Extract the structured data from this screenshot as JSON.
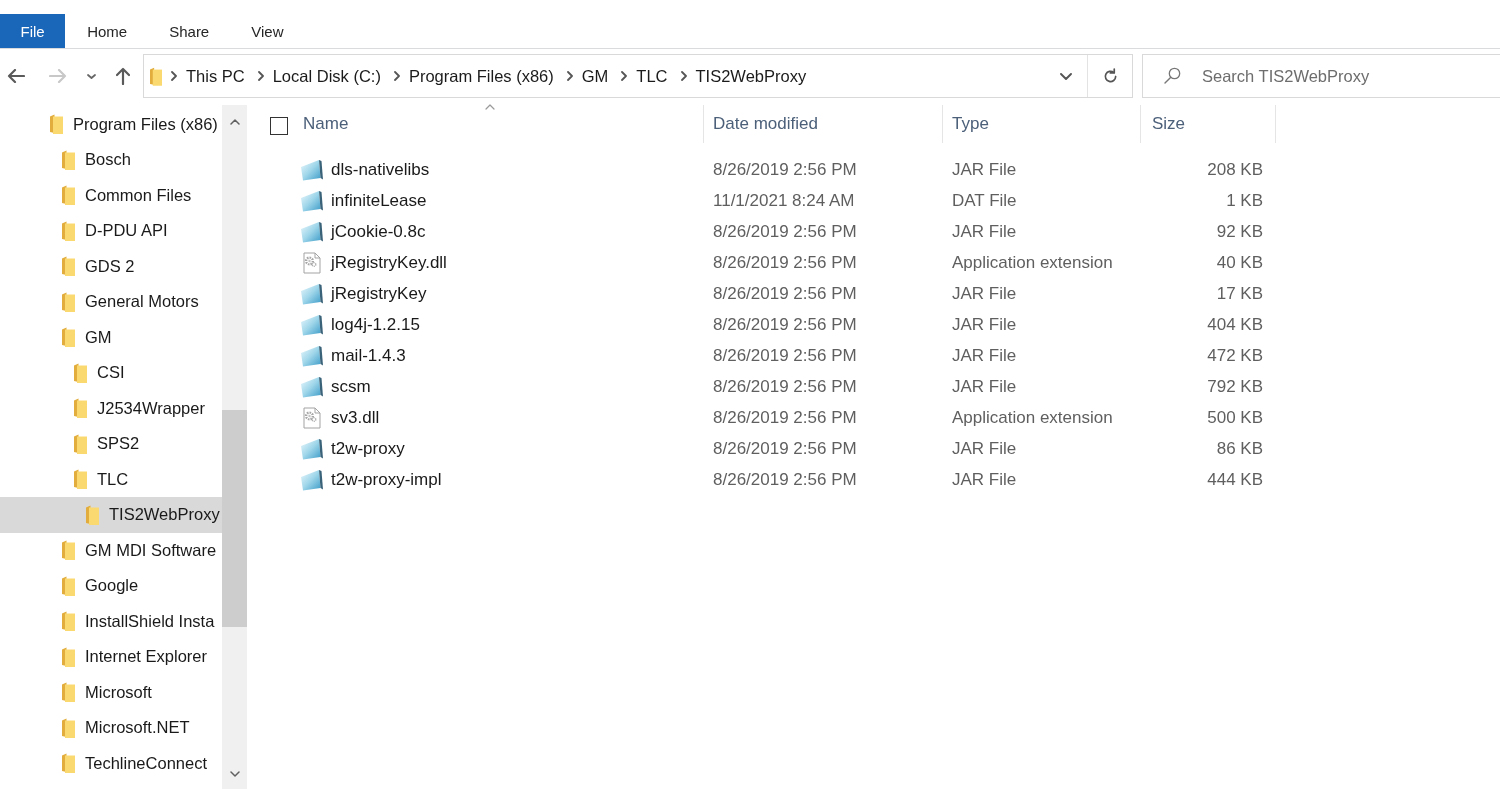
{
  "ribbon": {
    "tabs": [
      {
        "label": "File",
        "kind": "file"
      },
      {
        "label": "Home",
        "kind": "tab"
      },
      {
        "label": "Share",
        "kind": "tab"
      },
      {
        "label": "View",
        "kind": "tab"
      }
    ]
  },
  "navigation": {
    "buttons": [
      {
        "kind": "back",
        "disabled": false
      },
      {
        "kind": "forward",
        "disabled": true
      },
      {
        "kind": "recent",
        "disabled": false
      },
      {
        "kind": "up",
        "disabled": false
      }
    ]
  },
  "address_bar": {
    "path": [
      "This PC",
      "Local Disk (C:)",
      "Program Files (x86)",
      "GM",
      "TLC",
      "TIS2WebProxy"
    ]
  },
  "search": {
    "placeholder": "Search TIS2WebProxy"
  },
  "sidebar": {
    "items": [
      {
        "label": "Program Files (x86)",
        "selected": false,
        "children": [
          {
            "label": "Bosch",
            "selected": false
          },
          {
            "label": "Common Files",
            "selected": false
          },
          {
            "label": "D-PDU API",
            "selected": false
          },
          {
            "label": "GDS 2",
            "selected": false
          },
          {
            "label": "General Motors",
            "selected": false
          },
          {
            "label": "GM",
            "selected": false,
            "children": [
              {
                "label": "CSI",
                "selected": false
              },
              {
                "label": "J2534Wrapper",
                "selected": false
              },
              {
                "label": "SPS2",
                "selected": false
              },
              {
                "label": "TLC",
                "selected": false,
                "children": [
                  {
                    "label": "TIS2WebProxy",
                    "selected": true
                  }
                ]
              }
            ]
          },
          {
            "label": "GM MDI Software",
            "selected": false
          },
          {
            "label": "Google",
            "selected": false
          },
          {
            "label": "InstallShield Insta",
            "selected": false
          },
          {
            "label": "Internet Explorer",
            "selected": false
          },
          {
            "label": "Microsoft",
            "selected": false
          },
          {
            "label": "Microsoft.NET",
            "selected": false
          },
          {
            "label": "TechlineConnect",
            "selected": false
          }
        ]
      }
    ]
  },
  "file_list": {
    "select_all": {
      "checked": false
    },
    "columns": [
      {
        "label": "Name",
        "sorted": true
      },
      {
        "label": "Date modified",
        "sorted": false
      },
      {
        "label": "Type",
        "sorted": false
      },
      {
        "label": "Size",
        "sorted": false
      }
    ],
    "rows": [
      {
        "name": "dls-nativelibs",
        "kind": "file",
        "date_modified": "8/26/2019 2:56 PM",
        "type": "JAR File",
        "size": "208 KB"
      },
      {
        "name": "infiniteLease",
        "kind": "file",
        "date_modified": "11/1/2021 8:24 AM",
        "type": "DAT File",
        "size": "1 KB"
      },
      {
        "name": "jCookie-0.8c",
        "kind": "file",
        "date_modified": "8/26/2019 2:56 PM",
        "type": "JAR File",
        "size": "92 KB"
      },
      {
        "name": "jRegistryKey.dll",
        "kind": "dll",
        "date_modified": "8/26/2019 2:56 PM",
        "type": "Application extension",
        "size": "40 KB"
      },
      {
        "name": "jRegistryKey",
        "kind": "file",
        "date_modified": "8/26/2019 2:56 PM",
        "type": "JAR File",
        "size": "17 KB"
      },
      {
        "name": "log4j-1.2.15",
        "kind": "file",
        "date_modified": "8/26/2019 2:56 PM",
        "type": "JAR File",
        "size": "404 KB"
      },
      {
        "name": "mail-1.4.3",
        "kind": "file",
        "date_modified": "8/26/2019 2:56 PM",
        "type": "JAR File",
        "size": "472 KB"
      },
      {
        "name": "scsm",
        "kind": "file",
        "date_modified": "8/26/2019 2:56 PM",
        "type": "JAR File",
        "size": "792 KB"
      },
      {
        "name": "sv3.dll",
        "kind": "dll",
        "date_modified": "8/26/2019 2:56 PM",
        "type": "Application extension",
        "size": "500 KB"
      },
      {
        "name": "t2w-proxy",
        "kind": "file",
        "date_modified": "8/26/2019 2:56 PM",
        "type": "JAR File",
        "size": "86 KB"
      },
      {
        "name": "t2w-proxy-impl",
        "kind": "file",
        "date_modified": "8/26/2019 2:56 PM",
        "type": "JAR File",
        "size": "444 KB"
      }
    ]
  }
}
